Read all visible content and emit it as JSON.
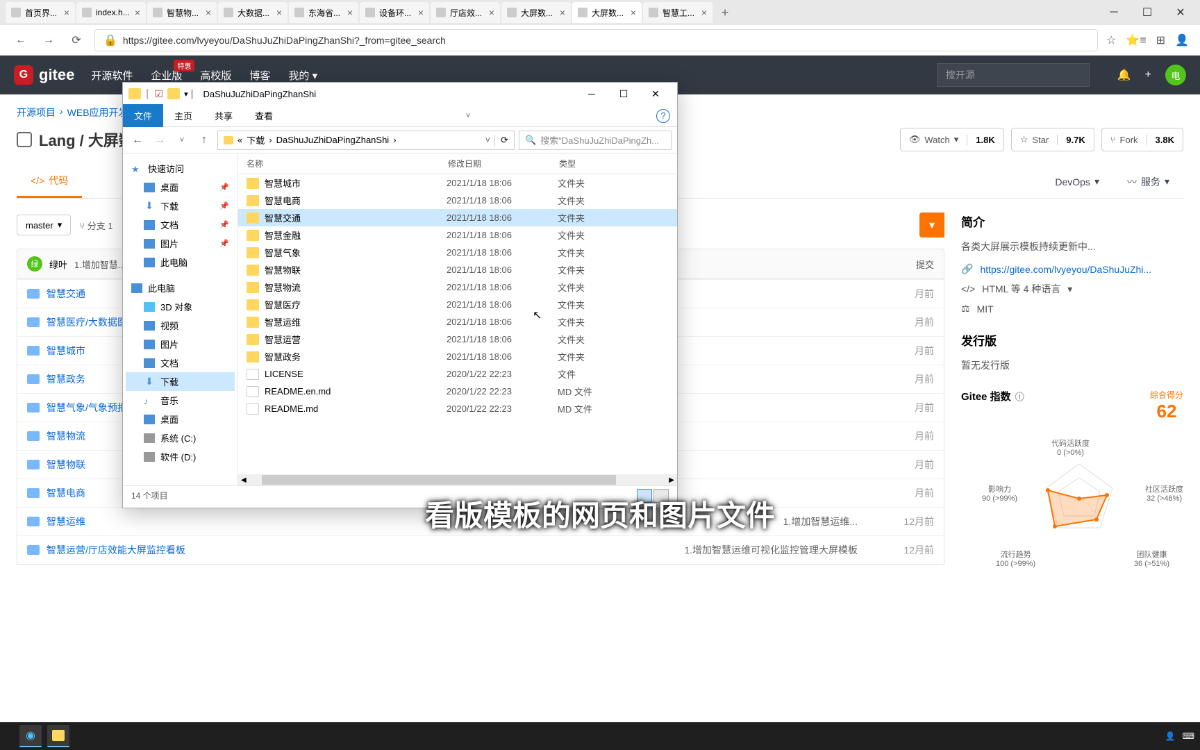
{
  "browser": {
    "tabs": [
      {
        "label": "首页界..."
      },
      {
        "label": "index.h..."
      },
      {
        "label": "智慧物..."
      },
      {
        "label": "大数据..."
      },
      {
        "label": "东海省..."
      },
      {
        "label": "设备环..."
      },
      {
        "label": "厅店效..."
      },
      {
        "label": "大屏数..."
      },
      {
        "label": "大屏数...",
        "active": true
      },
      {
        "label": "智慧工..."
      }
    ],
    "url": "https://gitee.com/lvyeyou/DaShuJuZhiDaPingZhanShi?_from=gitee_search"
  },
  "gitee": {
    "logo_letter": "G",
    "logo_text": "gitee",
    "nav": [
      "开源软件",
      "企业版",
      "高校版",
      "博客",
      "我的 ▾"
    ],
    "badge_hot": "特惠",
    "search_placeholder": "搜开源",
    "avatar_text": "电",
    "breadcrumb": [
      "开源项目",
      "WEB应用开发"
    ],
    "repo_title": "Lang / 大屏数...",
    "actions": {
      "watch": {
        "label": "Watch",
        "count": "1.8K"
      },
      "star": {
        "label": "Star",
        "count": "9.7K"
      },
      "fork": {
        "label": "Fork",
        "count": "3.8K"
      }
    },
    "tabs": {
      "code": "代码",
      "devops": "DevOps",
      "services": "服务"
    },
    "branch": "master",
    "branch_count": "分支 1",
    "commit_author": "绿叶",
    "commit_msg": "1.增加智慧...",
    "commit_badge": "绿",
    "commit_right": "提交",
    "files": [
      {
        "name": "智慧交通",
        "time": "月前"
      },
      {
        "name": "智慧医疗/大数据医...",
        "time": "月前"
      },
      {
        "name": "智慧城市",
        "time": "月前"
      },
      {
        "name": "智慧政务",
        "time": "月前"
      },
      {
        "name": "智慧气象/气象预报...",
        "time": "月前"
      },
      {
        "name": "智慧物流",
        "time": "月前"
      },
      {
        "name": "智慧物联",
        "time": "月前"
      },
      {
        "name": "智慧电商",
        "time": "月前"
      },
      {
        "name": "智慧运维",
        "msg": "1.增加智慧运维...",
        "time": "12月前"
      },
      {
        "name": "智慧运营/厅店效能大屏监控看板",
        "msg": "1.增加智慧运维可视化监控管理大屏模板",
        "time": "12月前"
      }
    ],
    "side": {
      "intro_title": "简介",
      "intro_text": "各类大屏展示模板持续更新中...",
      "link": "https://gitee.com/lvyeyou/DaShuJuZhi...",
      "lang": "HTML 等 4 种语言",
      "license": "MIT",
      "release_title": "发行版",
      "release_empty": "暂无发行版",
      "index_title": "Gitee 指数",
      "score_label": "综合得分",
      "score": "62",
      "radar": {
        "code_activity": {
          "label": "代码活跃度",
          "value": "0 (>0%)"
        },
        "community": {
          "label": "社区活跃度",
          "value": "32 (>46%)"
        },
        "team": {
          "label": "团队健康",
          "value": "36 (>51%)"
        },
        "trend": {
          "label": "流行趋势",
          "value": "100 (>99%)"
        },
        "influence": {
          "label": "影响力",
          "value": "90 (>99%)"
        }
      }
    }
  },
  "explorer": {
    "title": "DaShuJuZhiDaPingZhanShi",
    "ribbon": [
      "文件",
      "主页",
      "共享",
      "查看"
    ],
    "path": [
      "«",
      "下载",
      "›",
      "DaShuJuZhiDaPingZhanShi",
      "›"
    ],
    "search_placeholder": "搜索\"DaShuJuZhiDaPingZh...",
    "sidebar": {
      "quick": "快速访问",
      "desktop": "桌面",
      "downloads": "下载",
      "docs": "文档",
      "pics": "图片",
      "thispc": "此电脑",
      "thispc2": "此电脑",
      "3d": "3D 对象",
      "video": "视频",
      "pics2": "图片",
      "docs2": "文档",
      "downloads2": "下载",
      "music": "音乐",
      "desktop2": "桌面",
      "sysc": "系统 (C:)",
      "softd": "软件 (D:)"
    },
    "columns": {
      "name": "名称",
      "date": "修改日期",
      "type": "类型"
    },
    "files": [
      {
        "name": "智慧城市",
        "date": "2021/1/18 18:06",
        "type": "文件夹",
        "folder": true
      },
      {
        "name": "智慧电商",
        "date": "2021/1/18 18:06",
        "type": "文件夹",
        "folder": true
      },
      {
        "name": "智慧交通",
        "date": "2021/1/18 18:06",
        "type": "文件夹",
        "folder": true,
        "selected": true
      },
      {
        "name": "智慧金融",
        "date": "2021/1/18 18:06",
        "type": "文件夹",
        "folder": true
      },
      {
        "name": "智慧气象",
        "date": "2021/1/18 18:06",
        "type": "文件夹",
        "folder": true
      },
      {
        "name": "智慧物联",
        "date": "2021/1/18 18:06",
        "type": "文件夹",
        "folder": true
      },
      {
        "name": "智慧物流",
        "date": "2021/1/18 18:06",
        "type": "文件夹",
        "folder": true
      },
      {
        "name": "智慧医疗",
        "date": "2021/1/18 18:06",
        "type": "文件夹",
        "folder": true
      },
      {
        "name": "智慧运维",
        "date": "2021/1/18 18:06",
        "type": "文件夹",
        "folder": true
      },
      {
        "name": "智慧运营",
        "date": "2021/1/18 18:06",
        "type": "文件夹",
        "folder": true
      },
      {
        "name": "智慧政务",
        "date": "2021/1/18 18:06",
        "type": "文件夹",
        "folder": true
      },
      {
        "name": "LICENSE",
        "date": "2020/1/22 22:23",
        "type": "文件",
        "folder": false
      },
      {
        "name": "README.en.md",
        "date": "2020/1/22 22:23",
        "type": "MD 文件",
        "folder": false
      },
      {
        "name": "README.md",
        "date": "2020/1/22 22:23",
        "type": "MD 文件",
        "folder": false
      }
    ],
    "status": "14 个项目"
  },
  "caption": "看版模板的网页和图片文件"
}
